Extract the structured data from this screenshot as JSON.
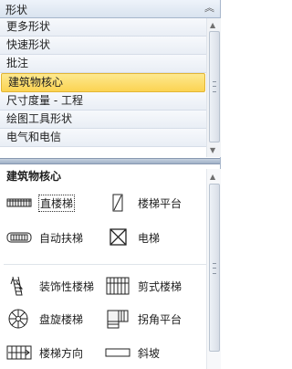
{
  "header": {
    "title": "形状",
    "collapse_icon": "chevron-up-double-icon",
    "collapse_glyph": "︽"
  },
  "menu": {
    "items": [
      {
        "label": "更多形状"
      },
      {
        "label": "快速形状"
      },
      {
        "label": "批注"
      },
      {
        "label": "建筑物核心",
        "selected": true
      },
      {
        "label": "尺寸度量 - 工程"
      },
      {
        "label": "绘图工具形状"
      },
      {
        "label": "电气和电信"
      }
    ]
  },
  "stencil": {
    "title": "建筑物核心",
    "shapes": [
      {
        "label": "直楼梯",
        "icon": "straight-stair-icon"
      },
      {
        "label": "楼梯平台",
        "icon": "stair-landing-icon"
      },
      {
        "label": "自动扶梯",
        "icon": "escalator-icon"
      },
      {
        "label": "电梯",
        "icon": "elevator-icon"
      },
      {
        "label": "装饰性楼梯",
        "icon": "decorative-stair-icon"
      },
      {
        "label": "剪式楼梯",
        "icon": "scissor-stair-icon"
      },
      {
        "label": "盘旋楼梯",
        "icon": "spiral-stair-icon"
      },
      {
        "label": "拐角平台",
        "icon": "corner-landing-icon"
      },
      {
        "label": "楼梯方向",
        "icon": "stair-direction-icon"
      },
      {
        "label": "斜坡",
        "icon": "ramp-icon"
      }
    ]
  },
  "colors": {
    "selected_bg": "#fbd352",
    "header_bg": "#d9e3ef",
    "divider": "#9fb0c7"
  }
}
